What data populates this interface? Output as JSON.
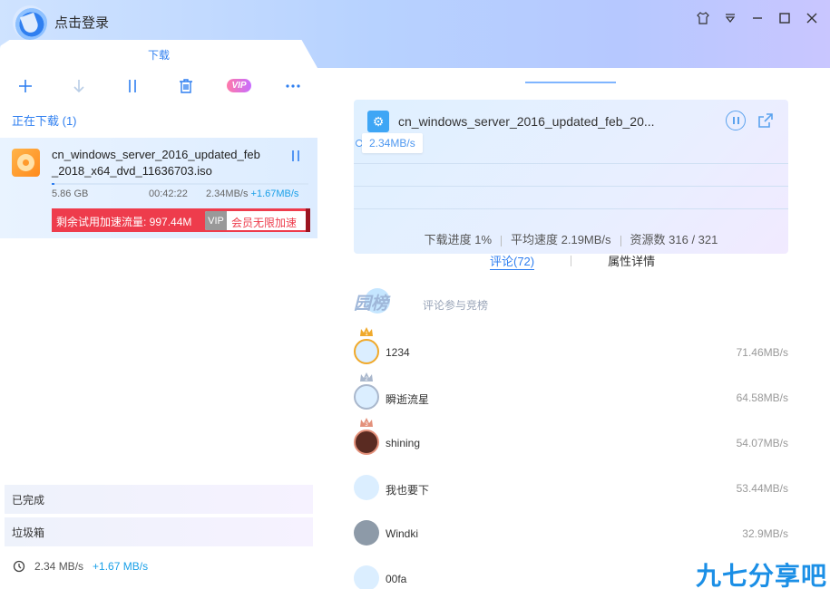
{
  "window": {
    "login_text": "点击登录",
    "controls": [
      "skin-icon",
      "menu-dropdown-icon",
      "minimize-icon",
      "maximize-icon",
      "close-icon"
    ]
  },
  "left": {
    "tab_label": "下载",
    "toolbar": {
      "vip_label": "VIP"
    },
    "section_downloading": "正在下载 (1)",
    "task": {
      "name": "cn_windows_server_2016_updated_feb_2018_x64_dvd_11636703.iso",
      "progress": 0.01,
      "size": "5.86 GB",
      "remaining": "00:42:22",
      "speed": "2.34MB/s",
      "accel": "+1.67MB/s",
      "trial_text": "剩余试用加速流量: 997.44M",
      "vip_tag": "VIP",
      "vip_label": "会员无限加速"
    },
    "completed_label": "已完成",
    "trash_label": "垃圾箱",
    "footer": {
      "speed": "2.34 MB/s",
      "accel": "+1.67 MB/s"
    }
  },
  "right": {
    "card": {
      "name": "cn_windows_server_2016_updated_feb_20...",
      "speed_bubble": "2.34MB/s",
      "progress_text": "下载进度 1%",
      "avg_speed": "平均速度 2.19MB/s",
      "resources": "资源数 316 / 321"
    },
    "tabs": {
      "comments": "评论(72)",
      "properties": "属性详情"
    },
    "rank_title": "园榜",
    "rank_sub": "评论参与竞榜",
    "ranks": [
      {
        "name": "1234",
        "speed": "71.46MB/s",
        "crown": "1",
        "crown_color": "#f0a92a",
        "avatar_color": "#dbeeff"
      },
      {
        "name": "瞬逝流星",
        "speed": "64.58MB/s",
        "crown": "2",
        "crown_color": "#a9b7cc",
        "avatar_color": "#dbeeff"
      },
      {
        "name": "shining",
        "speed": "54.07MB/s",
        "crown": "3",
        "crown_color": "#e3907a",
        "avatar_color": "#5a2b22"
      },
      {
        "name": "我也要下",
        "speed": "53.44MB/s",
        "crown": "",
        "crown_color": "",
        "avatar_color": "#dbeeff"
      },
      {
        "name": "Windki",
        "speed": "32.9MB/s",
        "crown": "",
        "crown_color": "",
        "avatar_color": "#8d9aa8"
      },
      {
        "name": "00fa",
        "speed": "",
        "crown": "",
        "crown_color": "",
        "avatar_color": "#dbeeff"
      }
    ]
  },
  "watermark": "九七分享吧",
  "colors": {
    "accent": "#2f7ff0",
    "trial_red": "#ee3c4c",
    "accel_blue": "#1aa0e8"
  }
}
